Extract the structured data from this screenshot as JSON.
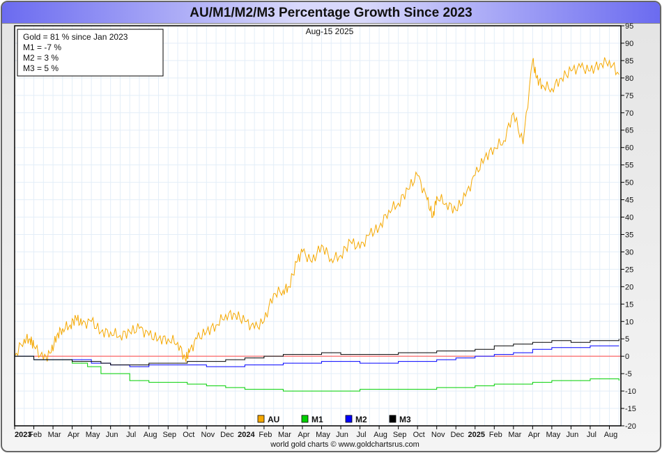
{
  "title": "AU/M1/M2/M3 Percentage Growth Since 2023",
  "chart_data": {
    "type": "line",
    "title": "AU/M1/M2/M3 Percentage Growth Since 2023",
    "date_label": "Aug-15  2025",
    "summary": [
      "Gold = 81 % since Jan 2023",
      "M1 = -7 %",
      "M2 = 3 %",
      "M3 = 5 %"
    ],
    "credit": "world gold charts © www.goldchartsrus.com",
    "ylim": [
      -20,
      95
    ],
    "yticks": [
      -20,
      -15,
      -10,
      -5,
      0,
      5,
      10,
      15,
      20,
      25,
      30,
      35,
      40,
      45,
      50,
      55,
      60,
      65,
      70,
      75,
      80,
      85,
      90,
      95
    ],
    "xlim_months": [
      0,
      31.6
    ],
    "xtick_labels": [
      "2023",
      "Feb",
      "Mar",
      "Apr",
      "May",
      "Jun",
      "Jul",
      "Aug",
      "Sep",
      "Oct",
      "Nov",
      "Dec",
      "2024",
      "Feb",
      "Mar",
      "Apr",
      "May",
      "Jun",
      "Jul",
      "Aug",
      "Sep",
      "Oct",
      "Nov",
      "Dec",
      "2025",
      "Feb",
      "Mar",
      "Apr",
      "May",
      "Jun",
      "Jul",
      "Aug"
    ],
    "x_unit": "months since Jan 2023",
    "zero_line_color": "#ff4040",
    "series": [
      {
        "name": "AU",
        "color": "#f5a800",
        "x": [
          0,
          0.5,
          0.8,
          1,
          1.5,
          1.9,
          2.2,
          2.5,
          2.9,
          3.2,
          3.5,
          4,
          4.5,
          5,
          5.5,
          6,
          6.5,
          7,
          7.5,
          8,
          8.5,
          8.9,
          9.1,
          9.5,
          10,
          10.5,
          11,
          11.5,
          12,
          12.5,
          13,
          13.5,
          14,
          14.3,
          14.7,
          15,
          15.5,
          16,
          16.5,
          17,
          17.5,
          18,
          18.5,
          19,
          19.5,
          20,
          20.5,
          21,
          21.5,
          21.8,
          22,
          22.5,
          23,
          23.5,
          24,
          24.5,
          25,
          25.5,
          26,
          26.5,
          27,
          27.2,
          27.5,
          28,
          28.5,
          29,
          29.5,
          30,
          30.5,
          31,
          31.5
        ],
        "y": [
          0,
          5,
          5,
          3,
          -1,
          1,
          6,
          8,
          9,
          11,
          9,
          10,
          7,
          7,
          6,
          7,
          8,
          6,
          5,
          5,
          4,
          -1,
          1,
          5,
          7,
          9,
          12,
          12,
          10,
          8,
          10,
          18,
          19,
          20,
          27,
          30,
          27,
          32,
          28,
          29,
          33,
          31,
          35,
          37,
          42,
          44,
          48,
          52,
          45,
          40,
          46,
          44,
          42,
          46,
          52,
          57,
          60,
          62,
          70,
          61,
          85,
          80,
          78,
          77,
          80,
          82,
          83,
          82,
          84,
          85,
          81
        ]
      },
      {
        "name": "M1",
        "color": "#00d000",
        "x": [
          0,
          1,
          2,
          3,
          3.8,
          4.5,
          6,
          7,
          9,
          10,
          11,
          12,
          14,
          16,
          18,
          20,
          22,
          24,
          25,
          27,
          28,
          30,
          31,
          31.5
        ],
        "y": [
          0,
          -1,
          -1,
          -2,
          -3,
          -5,
          -7,
          -7.5,
          -8,
          -8.5,
          -9,
          -9.5,
          -10,
          -10,
          -9.5,
          -9.5,
          -9,
          -8.5,
          -8,
          -7.5,
          -7,
          -6.5,
          -6.5,
          -7
        ]
      },
      {
        "name": "M2",
        "color": "#0000ff",
        "x": [
          0,
          1,
          3,
          4,
          5,
          6,
          7,
          9,
          10,
          12,
          14,
          16,
          17,
          18,
          20,
          22,
          23,
          24,
          25,
          26,
          27,
          28,
          29,
          30,
          31.5
        ],
        "y": [
          0,
          -1,
          -1,
          -2,
          -2.5,
          -3,
          -2.5,
          -2.5,
          -3,
          -2.5,
          -2,
          -1.5,
          -1.5,
          -2,
          -1.5,
          -1,
          -0.5,
          0,
          0.5,
          1,
          2,
          2.5,
          2.5,
          3,
          3
        ]
      },
      {
        "name": "M3",
        "color": "#000000",
        "x": [
          0,
          1,
          3,
          4.5,
          5,
          6,
          7,
          9,
          11,
          12,
          13,
          14,
          16,
          17,
          18,
          20,
          22,
          24,
          25,
          26,
          27,
          28,
          29,
          30,
          31.5
        ],
        "y": [
          0,
          -1,
          -1.5,
          -2,
          -2.5,
          -2.5,
          -2,
          -1.5,
          -1,
          -0.5,
          0,
          0.5,
          1,
          0.5,
          0.5,
          1,
          1.5,
          2,
          3,
          3.5,
          4,
          4.5,
          4,
          4.5,
          5
        ]
      }
    ],
    "legend": "bottom-center",
    "grid": true
  }
}
